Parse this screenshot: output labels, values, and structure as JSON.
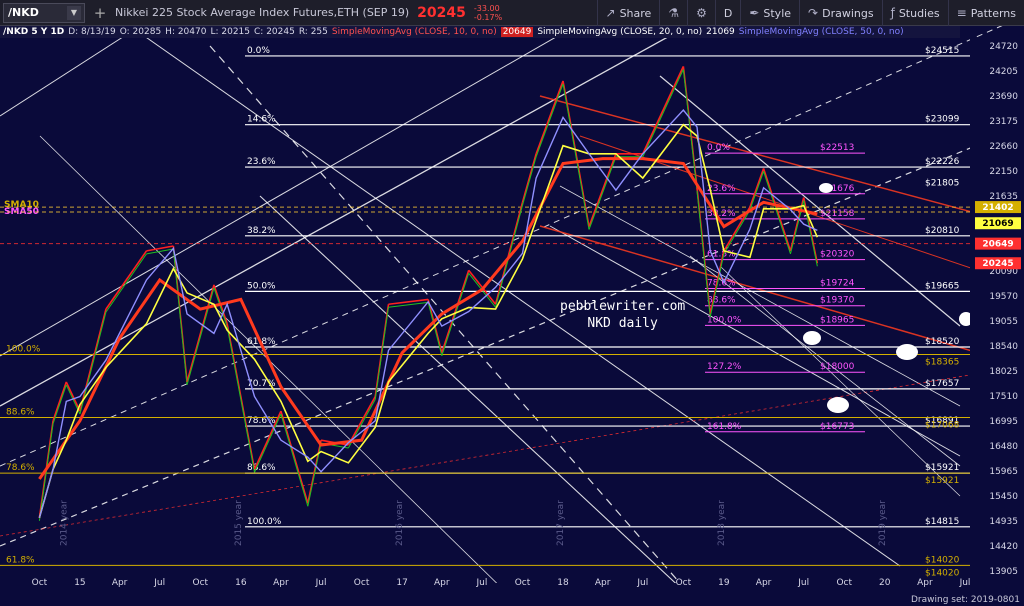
{
  "toolbar": {
    "symbol": "/NKD",
    "add_label": "+",
    "title": "Nikkei 225 Stock Average Index Futures,ETH (SEP 19)",
    "price": "20245",
    "change": "-33.00",
    "change_pct": "-0.17%",
    "share": "Share",
    "interval": "D",
    "style": "Style",
    "drawings": "Drawings",
    "studies": "Studies",
    "patterns": "Patterns"
  },
  "header": {
    "sym": "/NKD 5 Y 1D",
    "date": "D: 8/13/19",
    "open": "O: 20285",
    "high": "H: 20470",
    "low": "L: 20215",
    "close": "C: 20245",
    "vol": "R: 255",
    "sma10": "SimpleMovingAvg (CLOSE, 10, 0, no)",
    "sma10_val": "20649",
    "sma20": "SimpleMovingAvg (CLOSE, 20, 0, no)",
    "sma20_val": "21069",
    "sma50": "SimpleMovingAvg (CLOSE, 50, 0, no)"
  },
  "watermark": {
    "line1": "pebblewriter.com",
    "line2": "NKD daily"
  },
  "footer": {
    "drawing_set": "Drawing set: 2019-0801"
  },
  "colors": {
    "background": "#0a0a3a",
    "price_down": "#ff3030",
    "sma10": "#ff3030",
    "sma20": "#ffff40",
    "sma50": "#8080ff",
    "fib_white": "#ffffff",
    "fib_magenta": "#ff55ff",
    "fib_gold": "#d4b000"
  },
  "chart_data": {
    "type": "line",
    "series_name": "/NKD",
    "y_axis_ticks": [
      24720,
      24205,
      23690,
      23175,
      22660,
      22150,
      21635,
      21120,
      20605,
      20090,
      19570,
      19055,
      18540,
      18025,
      17510,
      16995,
      16480,
      15965,
      15450,
      14935,
      14420,
      13905
    ],
    "x_axis_ticks": [
      "Oct",
      "15",
      "Apr",
      "Jul",
      "Oct",
      "16",
      "Apr",
      "Jul",
      "Oct",
      "17",
      "Apr",
      "Jul",
      "Oct",
      "18",
      "Apr",
      "Jul",
      "Oct",
      "19",
      "Apr",
      "Jul",
      "Oct",
      "20",
      "Apr",
      "Jul"
    ],
    "year_labels": [
      "2014 year",
      "2015 year",
      "2016 year",
      "2017 year",
      "2018 year",
      "2019 year"
    ],
    "price_tags": [
      {
        "label": "21402",
        "value": 21402,
        "color": "#d4b000"
      },
      {
        "label": "21069",
        "value": 21069,
        "color": "#ffff40"
      },
      {
        "label": "20649",
        "value": 20649,
        "color": "#ff3030"
      },
      {
        "label": "20245",
        "value": 20245,
        "color": "#ff3030"
      }
    ],
    "left_tags": [
      {
        "label": "SMA10",
        "value": 21400
      },
      {
        "label": "SMA50",
        "value": 21260
      }
    ],
    "fib_white": [
      {
        "pct": "0.0%",
        "value": 24515
      },
      {
        "pct": "14.6%",
        "value": 23099
      },
      {
        "pct": "23.6%",
        "value": 22226
      },
      {
        "pct": "38.2%",
        "value": 20810
      },
      {
        "pct": "50.0%",
        "value": 19665
      },
      {
        "pct": "61.8%",
        "value": 18520
      },
      {
        "pct": "70.7%",
        "value": 17657
      },
      {
        "pct": "78.6%",
        "value": 16891
      },
      {
        "pct": "88.6%",
        "value": 15921
      },
      {
        "pct": "100.0%",
        "value": 14815
      }
    ],
    "fib_white_extra": [
      {
        "label": "14020",
        "value": 14020
      }
    ],
    "fib_magenta": [
      {
        "pct": "0.0%",
        "value": 22513
      },
      {
        "pct": "23.6%",
        "value": 21676
      },
      {
        "pct": "38.2%",
        "value": 21158
      },
      {
        "pct": "61.8%",
        "value": 20320
      },
      {
        "pct": "78.6%",
        "value": 19724
      },
      {
        "pct": "88.6%",
        "value": 19370
      },
      {
        "pct": "100.0%",
        "value": 18965
      },
      {
        "pct": "127.2%",
        "value": 18000
      },
      {
        "pct": "161.8%",
        "value": 16773
      }
    ],
    "fib_gold": [
      {
        "pct": "100.0%",
        "value": 18365
      },
      {
        "pct": "88.6%",
        "value": 17068
      },
      {
        "pct": "78.6%",
        "value": 15921
      },
      {
        "pct": "61.8%",
        "value": 14020
      }
    ],
    "top_labels": [
      {
        "label": "21805",
        "value": 21805
      }
    ],
    "price_path": [
      {
        "date": "2014-10",
        "value": 15000
      },
      {
        "date": "2014-11",
        "value": 17000
      },
      {
        "date": "2014-12",
        "value": 17800
      },
      {
        "date": "2015-01",
        "value": 17200
      },
      {
        "date": "2015-03",
        "value": 19300
      },
      {
        "date": "2015-06",
        "value": 20500
      },
      {
        "date": "2015-08",
        "value": 20600
      },
      {
        "date": "2015-09",
        "value": 17800
      },
      {
        "date": "2015-11",
        "value": 19800
      },
      {
        "date": "2015-12",
        "value": 19000
      },
      {
        "date": "2016-02",
        "value": 16000
      },
      {
        "date": "2016-04",
        "value": 17200
      },
      {
        "date": "2016-06",
        "value": 15300
      },
      {
        "date": "2016-07",
        "value": 16600
      },
      {
        "date": "2016-09",
        "value": 16500
      },
      {
        "date": "2016-11",
        "value": 17500
      },
      {
        "date": "2016-12",
        "value": 19400
      },
      {
        "date": "2017-03",
        "value": 19500
      },
      {
        "date": "2017-04",
        "value": 18400
      },
      {
        "date": "2017-06",
        "value": 20100
      },
      {
        "date": "2017-08",
        "value": 19400
      },
      {
        "date": "2017-10",
        "value": 21500
      },
      {
        "date": "2017-11",
        "value": 22500
      },
      {
        "date": "2018-01",
        "value": 24000
      },
      {
        "date": "2018-03",
        "value": 21000
      },
      {
        "date": "2018-05",
        "value": 22500
      },
      {
        "date": "2018-07",
        "value": 22500
      },
      {
        "date": "2018-10",
        "value": 24300
      },
      {
        "date": "2018-11",
        "value": 21800
      },
      {
        "date": "2018-12",
        "value": 19200
      },
      {
        "date": "2019-01",
        "value": 20500
      },
      {
        "date": "2019-03",
        "value": 21400
      },
      {
        "date": "2019-04",
        "value": 22200
      },
      {
        "date": "2019-06",
        "value": 20500
      },
      {
        "date": "2019-07",
        "value": 21600
      },
      {
        "date": "2019-08",
        "value": 20245
      }
    ],
    "sma50_path": [
      {
        "date": "2014-10",
        "value": 15800
      },
      {
        "date": "2015-01",
        "value": 17000
      },
      {
        "date": "2015-04",
        "value": 18700
      },
      {
        "date": "2015-07",
        "value": 19900
      },
      {
        "date": "2015-10",
        "value": 19300
      },
      {
        "date": "2016-01",
        "value": 19500
      },
      {
        "date": "2016-04",
        "value": 17700
      },
      {
        "date": "2016-07",
        "value": 16500
      },
      {
        "date": "2016-10",
        "value": 16600
      },
      {
        "date": "2017-01",
        "value": 18400
      },
      {
        "date": "2017-04",
        "value": 19200
      },
      {
        "date": "2017-07",
        "value": 19700
      },
      {
        "date": "2017-10",
        "value": 20700
      },
      {
        "date": "2018-01",
        "value": 22300
      },
      {
        "date": "2018-04",
        "value": 22400
      },
      {
        "date": "2018-07",
        "value": 22400
      },
      {
        "date": "2018-10",
        "value": 22300
      },
      {
        "date": "2019-01",
        "value": 21000
      },
      {
        "date": "2019-04",
        "value": 21500
      },
      {
        "date": "2019-08",
        "value": 21260
      }
    ],
    "annotations": [
      "pebblewriter.com",
      "NKD daily"
    ]
  }
}
